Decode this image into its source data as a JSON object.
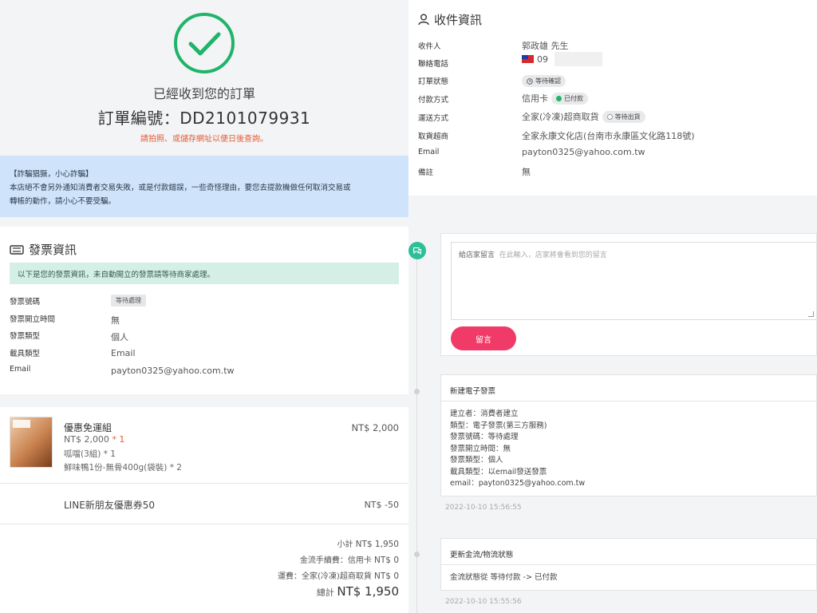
{
  "hero": {
    "received": "已經收到您的訂單",
    "order_number": "訂單編號：DD2101079931",
    "hint": "請拍照、或儲存網址以便日後查詢。"
  },
  "fraud": {
    "title": "【詐騙猖獗，小心詐騙】",
    "body": "本店絕不會另外通知消費者交易失敗，或是付款錯誤，一些奇怪理由，要您去提款機做任何取消交易或",
    "body2": "轉帳的動作，請小心不要受騙。"
  },
  "invoice": {
    "title": "發票資訊",
    "notice": "以下是您的發票資訊，未自動開立的發票請等待商家處理。",
    "rows": [
      {
        "key": "發票號碼",
        "value": "等待處理"
      },
      {
        "key": "發票開立時間",
        "value": "無"
      },
      {
        "key": "發票類型",
        "value": "個人"
      },
      {
        "key": "載具類型",
        "value": "Email"
      },
      {
        "key": "Email",
        "value": "payton0325@yahoo.com.tw"
      }
    ]
  },
  "items": {
    "product": {
      "name": "優惠免運組",
      "price": "NT$ 2,000",
      "qty": "* 1",
      "total": "NT$ 2,000",
      "options": [
        "呱噹(3組) * 1",
        "鮮味鴨1份-無骨400g(袋裝) * 2"
      ]
    },
    "coupon": {
      "name": "LINE新朋友優惠券50",
      "amount": "NT$ -50"
    },
    "summary": {
      "subtotal_label": "小計",
      "subtotal": "NT$ 1,950",
      "fee_label": "金流手續費：信用卡",
      "fee": "NT$ 0",
      "shipping_label": "運費：全家(冷凍)超商取貨",
      "shipping": "NT$ 0",
      "total_label": "總計",
      "total": "NT$ 1,950"
    }
  },
  "recipient": {
    "title": "收件資訊",
    "name_label": "收件人",
    "name": "郭政雄 先生",
    "phone_label": "聯絡電話",
    "phone": "09",
    "status_label": "訂單狀態",
    "status": "等待確認",
    "payment_label": "付款方式",
    "payment": "信用卡",
    "payment_status": "已付款",
    "delivery_label": "運送方式",
    "delivery": "全家(冷凍)超商取貨",
    "delivery_status": "等待出貨",
    "store_label": "取貨超商",
    "store": "全家永康文化店(台南市永康區文化路118號)",
    "email_label": "Email",
    "email": "payton0325@yahoo.com.tw",
    "note_label": "備註",
    "note": "無"
  },
  "message": {
    "label": "給店家留言",
    "placeholder": "在此輸入，店家將會看到您的留言",
    "button": "留言"
  },
  "logs": [
    {
      "title": "新建電子發票",
      "lines": [
        "建立者：消費者建立",
        "類型：電子發票(第三方服務)",
        "發票號碼：等待處理",
        "發票開立時間：無",
        "發票類型：個人",
        "載具類型：以email發送發票",
        "email：payton0325@yahoo.com.tw"
      ],
      "time": "2022-10-10 15:56:55"
    },
    {
      "title": "更新金流/物流狀態",
      "lines": [
        "金流狀態從 等待付款 -> 已付款"
      ],
      "time": "2022-10-10 15:55:56"
    }
  ],
  "colors": {
    "accent_green": "#1fb46a",
    "button_pink": "#f03a67",
    "notice_blue": "#cfe4fb",
    "notice_green": "#d3efe6"
  }
}
